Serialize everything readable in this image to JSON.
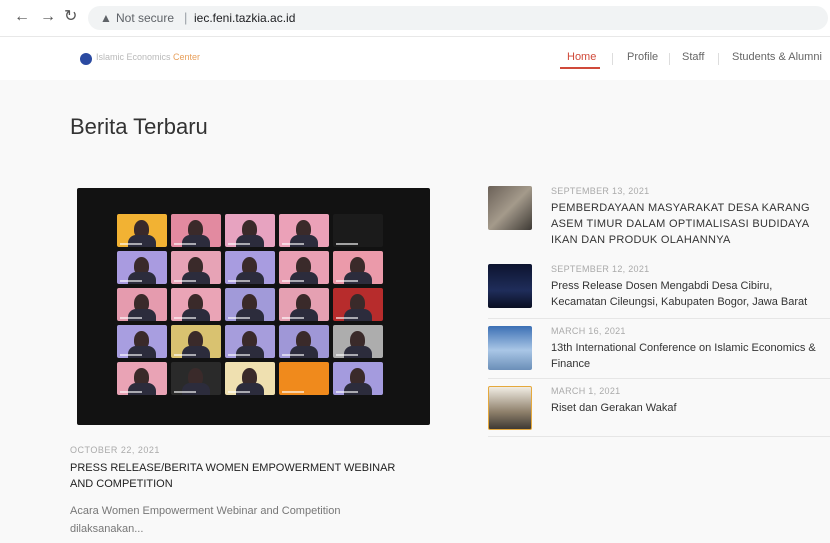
{
  "browser": {
    "back_icon": "←",
    "forward_icon": "→",
    "reload_icon": "↻",
    "security_icon": "▲",
    "security_label": "Not secure",
    "url_separator": "|",
    "url": "iec.feni.tazkia.ac.id"
  },
  "site": {
    "logo_text_main": "Islamic Economics",
    "logo_text_accent": " Center",
    "menu": [
      {
        "label": "Home",
        "active": true
      },
      {
        "label": "Profile",
        "active": false
      },
      {
        "label": "Staff",
        "active": false
      },
      {
        "label": "Students & Alumni",
        "active": false
      }
    ],
    "accent_color": "#d04a3a"
  },
  "main": {
    "section_title": "Berita Terbaru",
    "featured": {
      "date": "OCTOBER 22, 2021",
      "title": "PRESS RELEASE/BERITA WOMEN EMPOWERMENT WEBINAR AND COMPETITION",
      "excerpt": "Acara Women Empowerment Webinar and Competition dilaksanakan..."
    },
    "news": [
      {
        "date": "SEPTEMBER 13, 2021",
        "title": "PEMBERDAYAAN MASYARAKAT DESA KARANG ASEM TIMUR DALAM OPTIMALISASI BUDIDAYA IKAN DAN PRODUK OLAHANNYA",
        "caps": true
      },
      {
        "date": "SEPTEMBER 12, 2021",
        "title": "Press Release Dosen Mengabdi Desa Cibiru, Kecamatan Cileungsi, Kabupaten Bogor, Jawa Barat",
        "caps": false
      },
      {
        "date": "MARCH 16, 2021",
        "title": "13th International Conference on Islamic Economics & Finance",
        "caps": false
      },
      {
        "date": "MARCH 1, 2021",
        "title": "Riset dan Gerakan Wakaf",
        "caps": false
      }
    ]
  }
}
